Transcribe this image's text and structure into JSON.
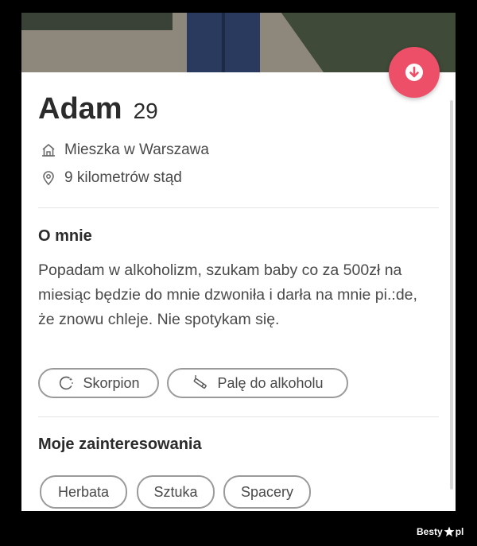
{
  "profile": {
    "name": "Adam",
    "age": "29",
    "location": "Mieszka w Warszawa",
    "distance": "9 kilometrów stąd"
  },
  "about": {
    "title": "O mnie",
    "bio": "Popadam w alkoholizm, szukam baby co za 500zł na miesiąc będzie do mnie dzwoniła i darła na mnie pi.:de, że znowu chleje. Nie spotykam się.",
    "tags": [
      {
        "label": "Skorpion",
        "icon": "zodiac-icon"
      },
      {
        "label": "Palę do alkoholu",
        "icon": "smoking-icon"
      }
    ]
  },
  "interests": {
    "title": "Moje zainteresowania",
    "items": [
      "Herbata",
      "Sztuka",
      "Spacery"
    ]
  },
  "actions": {
    "dislike_icon": "arrow-down-icon",
    "dislike_color": "#ee4f68"
  },
  "watermark": {
    "text_left": "Besty",
    "text_right": "pl"
  }
}
